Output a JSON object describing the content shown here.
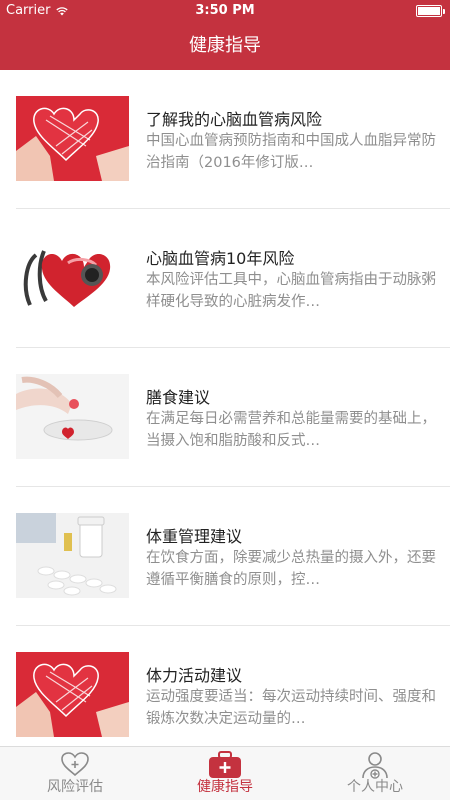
{
  "status_bar": {
    "carrier": "Carrier",
    "time": "3:50 PM"
  },
  "nav": {
    "title": "健康指导"
  },
  "articles": [
    {
      "title": "了解我的心脑血管病风险",
      "desc": "中国心血管病预防指南和中国成人血脂异常防治指南（2016年修订版…",
      "image": "heart-hands-image"
    },
    {
      "title": "心脑血管病10年风险",
      "desc": "本风险评估工具中，心脑血管病指由于动脉粥样硬化导致的心脏病发作…",
      "image": "heart-stethoscope-image"
    },
    {
      "title": "膳食建议",
      "desc": "在满足每日必需营养和总能量需要的基础上，当摄入饱和脂肪酸和反式…",
      "image": "hands-heart-pill-image"
    },
    {
      "title": "体重管理建议",
      "desc": "在饮食方面，除要减少总热量的摄入外，还要遵循平衡膳食的原则，控…",
      "image": "pills-bottle-image"
    },
    {
      "title": "体力活动建议",
      "desc": "运动强度要适当：每次运动持续时间、强度和锻炼次数决定运动量的…",
      "image": "heart-hands-image"
    }
  ],
  "tabs": [
    {
      "label": "风险评估",
      "icon": "heart-plus-icon",
      "active": false
    },
    {
      "label": "健康指导",
      "icon": "medical-kit-icon",
      "active": true
    },
    {
      "label": "个人中心",
      "icon": "user-plus-icon",
      "active": false
    }
  ],
  "colors": {
    "brand": "#c4323f",
    "inactive": "#8a8a8a"
  }
}
